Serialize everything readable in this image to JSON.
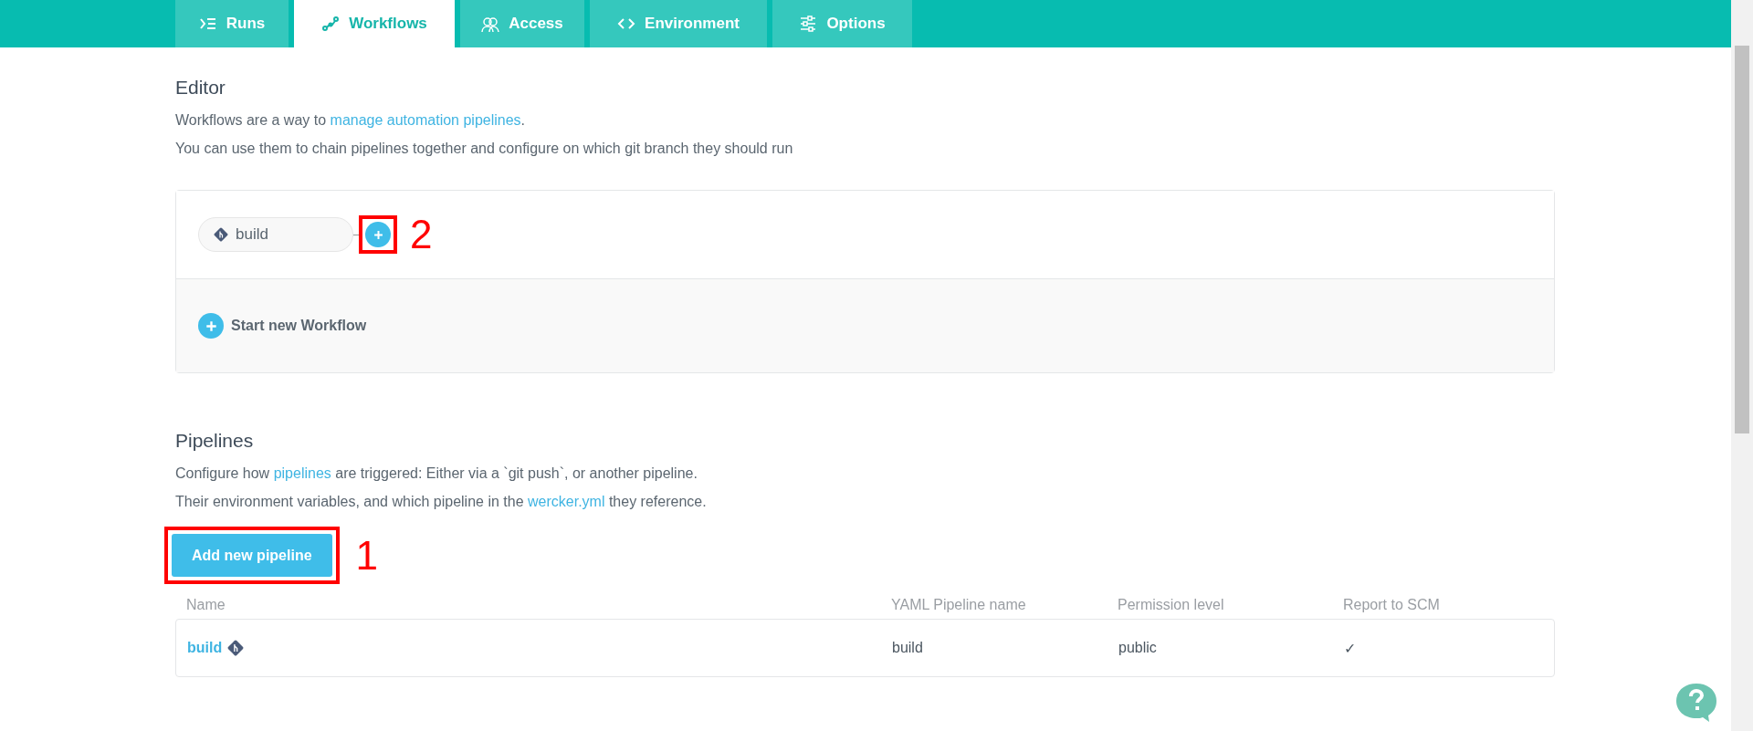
{
  "tabs": [
    {
      "label": "Runs",
      "selected": false
    },
    {
      "label": "Workflows",
      "selected": true
    },
    {
      "label": "Access",
      "selected": false
    },
    {
      "label": "Environment",
      "selected": false
    },
    {
      "label": "Options",
      "selected": false
    }
  ],
  "editor": {
    "title": "Editor",
    "intro": [
      {
        "text": "Workflows are a way to ",
        "link": "manage automation pipelines",
        "after": "."
      },
      {
        "text": "You can use them to chain pipelines together and configure on which git branch they should run"
      }
    ],
    "workflow": {
      "pipeline": "build",
      "add_annotation": "2"
    },
    "start_button": "Start new Workflow"
  },
  "pipelines": {
    "title": "Pipelines",
    "intro": [
      {
        "text": "Configure how ",
        "link": "pipelines",
        "after": " are triggered: Either via a `git push`, or another pipeline."
      },
      {
        "text": "Their environment variables, and which pipeline in the ",
        "link": "wercker.yml",
        "after": " they reference."
      }
    ],
    "add_button": "Add new pipeline",
    "add_annotation": "1",
    "table": {
      "columns": [
        "Name",
        "YAML Pipeline name",
        "Permission level",
        "Report to SCM"
      ],
      "rows": [
        {
          "name": "build",
          "yaml": "build",
          "permission": "public",
          "report": "✓"
        }
      ]
    }
  }
}
